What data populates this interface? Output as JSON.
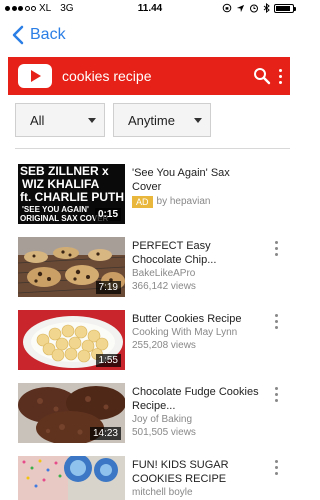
{
  "status_bar": {
    "carrier": "XL",
    "network": "3G",
    "time": "11.44",
    "battery_level": 0.85
  },
  "nav": {
    "back_label": "Back"
  },
  "header": {
    "query": "cookies recipe",
    "brand_color": "#e62117"
  },
  "filters": {
    "type": "All",
    "time": "Anytime"
  },
  "results": [
    {
      "title": "'See You Again' Sax Cover",
      "ad_label": "AD",
      "channel": "by hepavian",
      "duration": "0:15",
      "thumb_lines": [
        "SEB ZILLNER x",
        "WIZ KHALIFA",
        "ft. CHARLIE PUTH",
        "'SEE YOU AGAIN'",
        "ORIGINAL SAX COVER"
      ]
    },
    {
      "title": "PERFECT Easy Chocolate Chip...",
      "channel": "BakeLikeAPro",
      "views": "366,142 views",
      "duration": "7:19"
    },
    {
      "title": "Butter Cookies Recipe",
      "channel": "Cooking With May Lynn",
      "views": "255,208 views",
      "duration": "1:55"
    },
    {
      "title": "Chocolate Fudge Cookies Recipe...",
      "channel": "Joy of Baking",
      "views": "501,505 views",
      "duration": "14:23"
    },
    {
      "title": "FUN! KIDS SUGAR COOKIES RECIPE",
      "channel": "mitchell boyle"
    }
  ]
}
